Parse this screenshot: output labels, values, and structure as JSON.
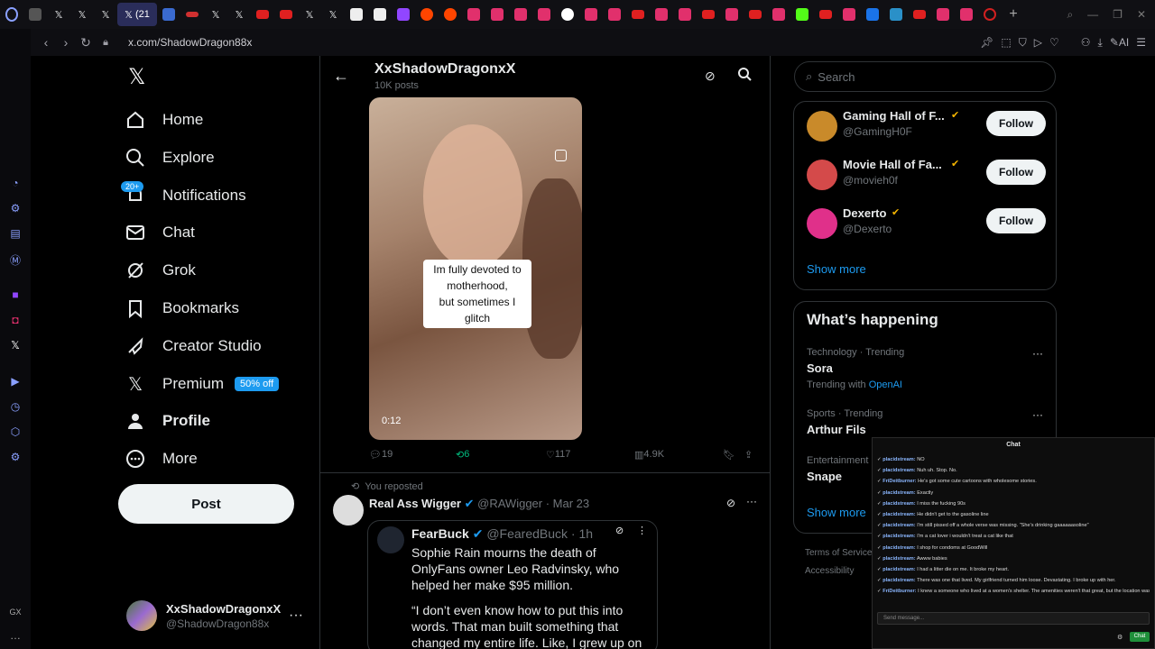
{
  "browser": {
    "url": "x.com/ShadowDragon88x",
    "active_tab_label": "(21",
    "ai_label": "AI",
    "gx_label": "GX"
  },
  "left_nav": {
    "items": [
      {
        "label": "Home",
        "icon": "home-icon"
      },
      {
        "label": "Explore",
        "icon": "search-icon"
      },
      {
        "label": "Notifications",
        "icon": "bell-icon"
      },
      {
        "label": "Chat",
        "icon": "mail-icon"
      },
      {
        "label": "Grok",
        "icon": "grok-icon"
      },
      {
        "label": "Bookmarks",
        "icon": "bookmark-icon"
      },
      {
        "label": "Creator Studio",
        "icon": "rocket-icon"
      },
      {
        "label": "Premium",
        "icon": "x-logo-icon"
      },
      {
        "label": "Profile",
        "icon": "person-icon"
      },
      {
        "label": "More",
        "icon": "more-circle-icon"
      }
    ],
    "notif_badge": "20+",
    "premium_badge": "50% off",
    "post_button": "Post",
    "account": {
      "name": "XxShadowDragonxX",
      "handle": "@ShadowDragon88x"
    }
  },
  "header": {
    "title": "XxShadowDragonxX",
    "subtitle": "10K posts"
  },
  "video_post": {
    "caption_lines": [
      "Im fully devoted to",
      "motherhood,",
      "but sometimes I glitch"
    ],
    "duration": "0:12",
    "replies": "19",
    "reposts": "6",
    "likes": "117",
    "views": "4.9K"
  },
  "repost": {
    "banner": "You reposted",
    "author": "Real Ass Wigger",
    "handle": "@RAWigger",
    "date": "· Mar 23",
    "quote_author": "FearBuck",
    "quote_handle": "@FearedBuck",
    "quote_time": "· 1h",
    "quote_text_1": "Sophie Rain mourns the death of OnlyFans owner Leo Radvinsky, who helped her make $95 million.",
    "quote_text_2": "“I don’t even know how to put this into words. That man built something that changed my entire life. Like, I grew up on"
  },
  "right": {
    "search_placeholder": "Search",
    "who_to_follow": [
      {
        "name": "Gaming Hall of F...",
        "handle": "@GamingH0F",
        "button": "Follow",
        "color": "#c98a2a"
      },
      {
        "name": "Movie Hall of Fa...",
        "handle": "@movieh0f",
        "button": "Follow",
        "color": "#d44a4a"
      },
      {
        "name": "Dexerto",
        "handle": "@Dexerto",
        "button": "Follow",
        "color": "#e0308a"
      }
    ],
    "show_more": "Show more",
    "happening_title": "What’s happening",
    "trends": [
      {
        "context": "Technology · Trending",
        "name": "Sora",
        "extra_prefix": "Trending with",
        "extra_link": "OpenAI"
      },
      {
        "context": "Sports · Trending",
        "name": "Arthur Fils"
      },
      {
        "context": "Entertainment",
        "name": "Snape"
      }
    ],
    "show_more_2": "Show more",
    "footer_1": "Terms of Service",
    "footer_2": "Accessibility"
  },
  "chat": {
    "title": "Chat",
    "lines": [
      {
        "user": "placidstream:",
        "text": "NO"
      },
      {
        "user": "placidstream:",
        "text": "Nuh uh. Stop. No."
      },
      {
        "user": "FriDeitburner:",
        "text": "He's got some cute cartoons with wholesome stories."
      },
      {
        "user": "placidstream:",
        "text": "Exactly"
      },
      {
        "user": "placidstream:",
        "text": "I miss the fucking 90s"
      },
      {
        "user": "placidstream:",
        "text": "He didn't get to the gasoline line"
      },
      {
        "user": "placidstream:",
        "text": "I'm still pissed off a whole verse was missing. \"She's drinking gaaaaaasoline\""
      },
      {
        "user": "placidstream:",
        "text": "I'm a cat lover i wouldn't treat a cat like that"
      },
      {
        "user": "placidstream:",
        "text": "I shop for condoms at GoodWill"
      },
      {
        "user": "placidstream:",
        "text": "Awww babies"
      },
      {
        "user": "placidstream:",
        "text": "I had a litter die on me. It broke my heart."
      },
      {
        "user": "placidstream:",
        "text": "There was one that lived. My girlfriend turned him loose. Devastating. I broke up with her."
      },
      {
        "user": "FriDeitburner:",
        "text": "I knew a someone who lived at a women's shelter. The amenities weren't that great, but the location was unbeatable"
      }
    ],
    "input_placeholder": "Send message...",
    "send_label": "Chat"
  }
}
